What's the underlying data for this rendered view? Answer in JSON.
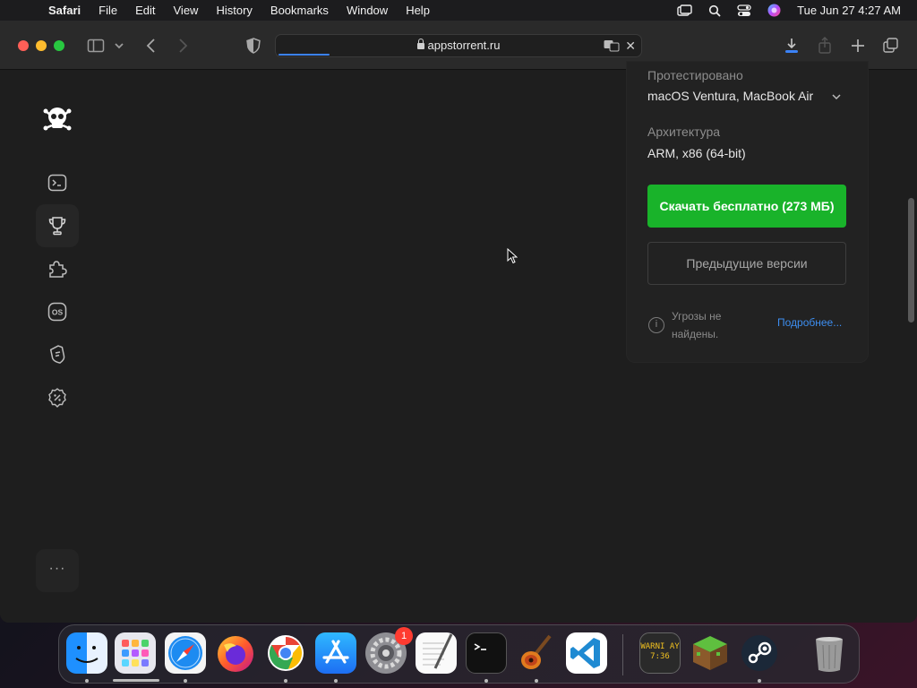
{
  "menubar": {
    "app_name": "Safari",
    "menus": [
      "File",
      "Edit",
      "View",
      "History",
      "Bookmarks",
      "Window",
      "Help"
    ],
    "clock": "Tue Jun 27  4:27 AM"
  },
  "browser": {
    "url": "appstorrent.ru",
    "page_load_progress": 0.14
  },
  "sidebar": {
    "logo": "skull-logo",
    "items": [
      {
        "name": "terminal",
        "icon": "terminal-icon"
      },
      {
        "name": "trophy",
        "icon": "trophy-icon",
        "active": true
      },
      {
        "name": "puzzle",
        "icon": "puzzle-icon"
      },
      {
        "name": "os",
        "icon": "os-icon",
        "text": "OS"
      },
      {
        "name": "shield",
        "icon": "shield-icon"
      },
      {
        "name": "discount",
        "icon": "discount-badge-icon"
      }
    ],
    "more": "···"
  },
  "panel": {
    "tested_label": "Протестировано",
    "tested_value": "macOS Ventura, MacBook Air",
    "arch_label": "Архитектура",
    "arch_value": "ARM, x86 (64-bit)",
    "download_button": "Скачать бесплатно (273 МБ)",
    "prev_versions_button": "Предыдущие версии",
    "threat_text": "Угрозы не найдены.",
    "more_link": "Подробнее..."
  },
  "dock": {
    "apps": [
      "Finder",
      "Launchpad",
      "Safari",
      "Firefox",
      "Chrome",
      "App Store",
      "System Settings",
      "TextEdit",
      "Terminal",
      "GarageBand",
      "Visual Studio Code",
      "Console",
      "Minecraft",
      "Steam",
      "Trash"
    ],
    "settings_badge": "1",
    "console_text": "WARNI AY 7:36"
  },
  "colors": {
    "download_green": "#19b32a",
    "link_blue": "#3d8ef0",
    "background": "#1e1e1e"
  }
}
